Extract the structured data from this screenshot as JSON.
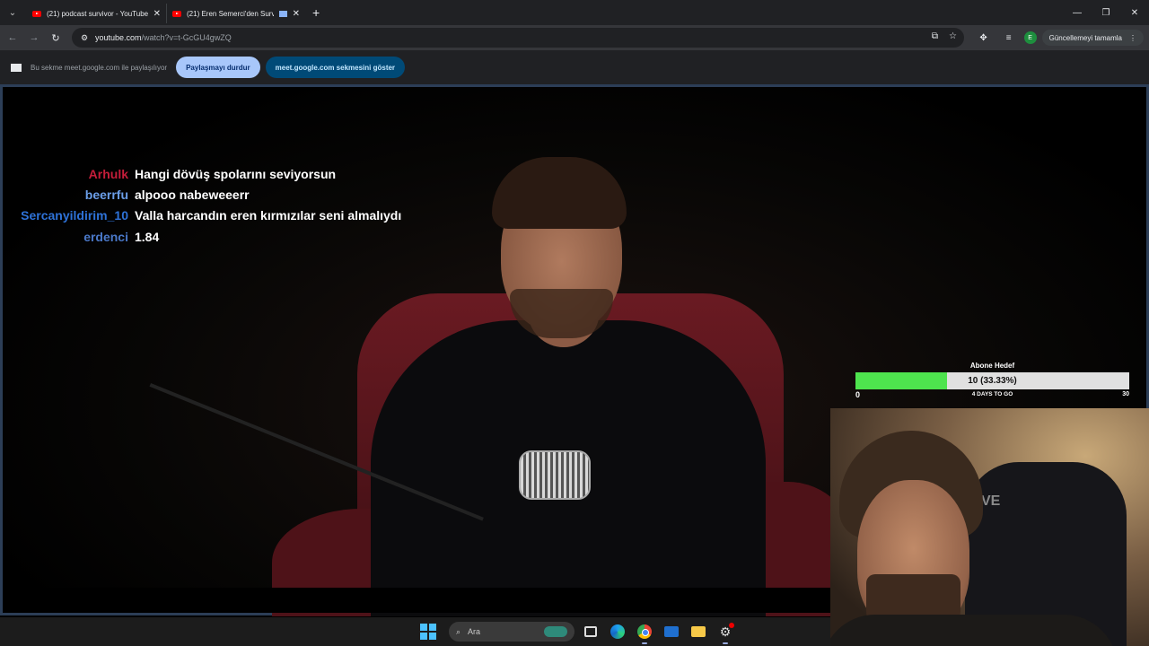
{
  "browser": {
    "tabs": [
      {
        "title": "(21) podcast survivor - YouTube",
        "close": "✕"
      },
      {
        "title": "(21) Eren Semerci'den Surv",
        "close": "✕"
      }
    ],
    "new_tab": "+",
    "window_controls": {
      "minimize": "—",
      "maximize": "❐",
      "close": "✕"
    },
    "address": {
      "host": "youtube.com",
      "path": "/watch?v=t-GcGU4gwZQ"
    },
    "update_button": "Güncellemeyi tamamla",
    "profile_initial": "E"
  },
  "share_bar": {
    "text": "Bu sekme meet.google.com ile paylaşılıyor",
    "stop_button": "Paylaşmayı durdur",
    "show_button": "meet.google.com sekmesini göster"
  },
  "chat": [
    {
      "user": "Arhulk",
      "color": "#c51d3a",
      "message": "Hangi dövüş spolarını seviyorsun"
    },
    {
      "user": "beerrfu",
      "color": "#6b9ee8",
      "message": "alpooo nabeweeerr"
    },
    {
      "user": "Sercanyildirim_10",
      "color": "#2e72d8",
      "message": "Valla harcandın eren kırmızılar seni almalıydı"
    },
    {
      "user": "erdenci",
      "color": "#4a78c8",
      "message": "1.84"
    }
  ],
  "goal": {
    "title": "Abone Hedef",
    "value_text": "10 (33.33%)",
    "progress": 0.3333,
    "min": "0",
    "days_left": "4 DAYS TO GO",
    "max": "30",
    "fill_color": "#4ee44e"
  },
  "webcam": {
    "chair_logo": "VE"
  },
  "taskbar": {
    "search_placeholder": "Ara",
    "apps": [
      "windows-start",
      "search",
      "task-view",
      "edge",
      "chrome",
      "mail",
      "file-explorer",
      "settings"
    ]
  }
}
